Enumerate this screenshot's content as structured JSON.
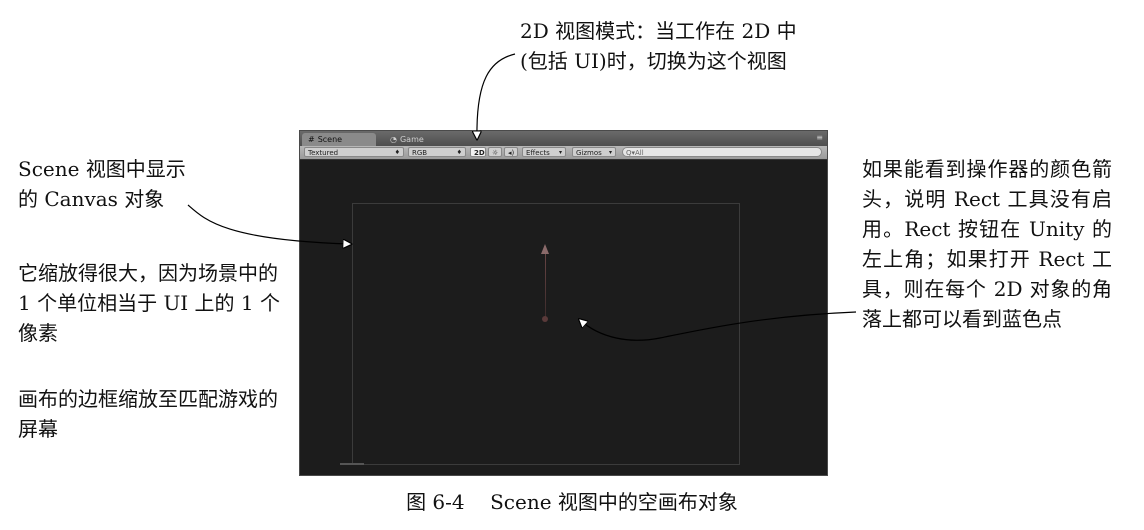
{
  "annotations": {
    "top": [
      "2D 视图模式：当工作在 2D 中",
      "(包括 UI)时，切换为这个视图"
    ],
    "left_canvas": [
      "Scene 视图中显示",
      "的 Canvas 对象"
    ],
    "left_scale": "它缩放得很大，因为场景中的 1 个单位相当于 UI 上的 1 个像素",
    "left_border": "画布的边框缩放至匹配游戏的屏幕",
    "right_rect": "如果能看到操作器的颜色箭头，说明 Rect 工具没有启用。Rect 按钮在 Unity 的左上角；如果打开 Rect 工具，则在每个 2D 对象的角落上都可以看到蓝色点"
  },
  "window": {
    "tabs": [
      {
        "label": "Scene",
        "icon": "scene-hash-icon"
      },
      {
        "label": "Game",
        "icon": "game-pacman-icon"
      }
    ],
    "toolbar": {
      "shading_mode": "Textured",
      "render_mode": "RGB",
      "mode_2d": "2D",
      "lighting_icon": "sun-icon",
      "audio_icon": "speaker-icon",
      "effects": "Effects",
      "gizmos": "Gizmos",
      "search_placeholder": "Q▾All"
    }
  },
  "caption": {
    "number": "图 6-4",
    "title": "Scene 视图中的空画布对象"
  },
  "colors": {
    "viewport_bg": "#1c1c1c",
    "toolbar_bg": "#a8a8a8",
    "gizmo_arrow": "#8a6a6a"
  }
}
